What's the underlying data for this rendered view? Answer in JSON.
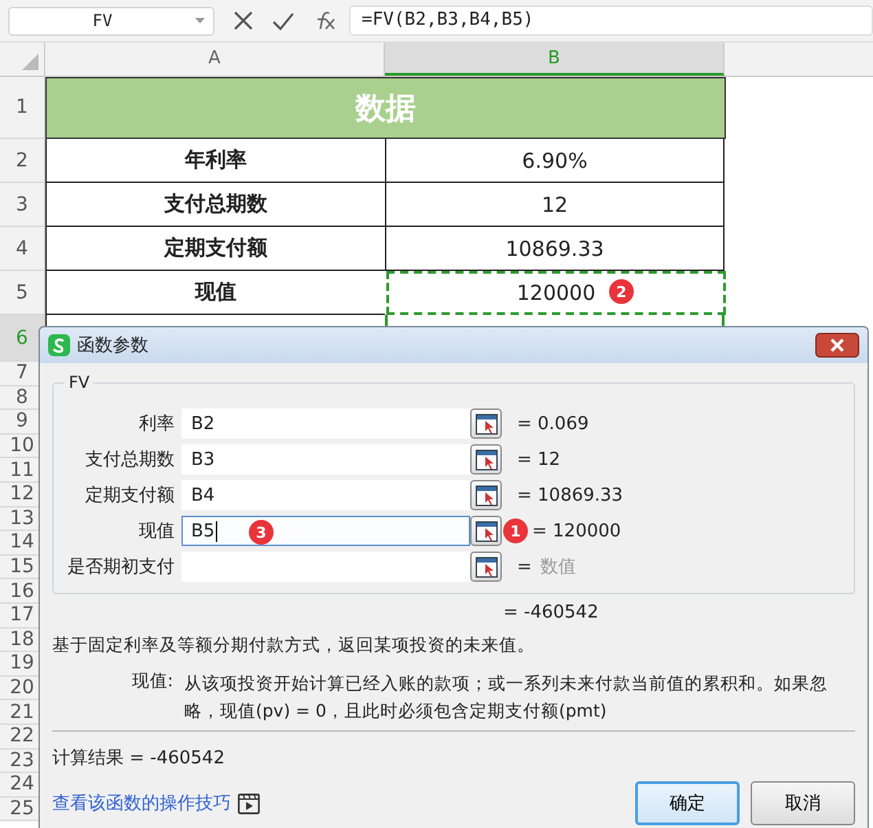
{
  "formula_bar": {
    "name_box": "FV",
    "formula": "=FV(B2,B3,B4,B5)"
  },
  "columns": [
    {
      "label": "A",
      "selected": false
    },
    {
      "label": "B",
      "selected": true
    }
  ],
  "sheet": {
    "title": "数据",
    "rows": [
      {
        "label": "年利率",
        "value": "6.90%",
        "marquee": false
      },
      {
        "label": "支付总期数",
        "value": "12",
        "marquee": false
      },
      {
        "label": "定期支付额",
        "value": "10869.33",
        "marquee": false
      },
      {
        "label": "现值",
        "value": "120000",
        "marquee": true,
        "badge": "2"
      }
    ]
  },
  "row_headers": [
    {
      "label": "1",
      "selected": false
    },
    {
      "label": "2",
      "selected": false
    },
    {
      "label": "3",
      "selected": false
    },
    {
      "label": "4",
      "selected": false
    },
    {
      "label": "5",
      "selected": false
    },
    {
      "label": "6",
      "selected": true
    },
    {
      "label": "7",
      "selected": false
    },
    {
      "label": "8",
      "selected": false
    },
    {
      "label": "9",
      "selected": false
    },
    {
      "label": "10",
      "selected": false
    },
    {
      "label": "11",
      "selected": false
    },
    {
      "label": "12",
      "selected": false
    },
    {
      "label": "13",
      "selected": false
    },
    {
      "label": "14",
      "selected": false
    },
    {
      "label": "15",
      "selected": false
    },
    {
      "label": "16",
      "selected": false
    },
    {
      "label": "17",
      "selected": false
    },
    {
      "label": "18",
      "selected": false
    },
    {
      "label": "19",
      "selected": false
    },
    {
      "label": "20",
      "selected": false
    },
    {
      "label": "21",
      "selected": false
    },
    {
      "label": "22",
      "selected": false
    },
    {
      "label": "23",
      "selected": false
    },
    {
      "label": "24",
      "selected": false
    },
    {
      "label": "25",
      "selected": false
    }
  ],
  "dialog": {
    "title": "函数参数",
    "group": "FV",
    "args": [
      {
        "kind": "value",
        "label": "利率",
        "value": "B2",
        "focused": false,
        "result": "= 0.069"
      },
      {
        "kind": "value",
        "label": "支付总期数",
        "value": "B3",
        "focused": false,
        "result": "= 12"
      },
      {
        "kind": "value",
        "label": "定期支付额",
        "value": "B4",
        "focused": false,
        "result": "= 10869.33"
      },
      {
        "kind": "value",
        "label": "现值",
        "value": "B5",
        "focused": true,
        "field_badge": "3",
        "button_badge": "1",
        "result": "= 120000"
      },
      {
        "kind": "hint",
        "label": "是否期初支付",
        "focused": false,
        "result_prefix": "=",
        "result": "数值"
      }
    ],
    "formula_result": "= -460542",
    "description": "基于固定利率及等额分期付款方式，返回某项投资的未来值。",
    "param_label": "现值:",
    "param_text": "从该项投资开始计算已经入账的款项；或一系列未来付款当前值的累积和。如果忽略，现值(pv) = 0，且此时必须包含定期支付额(pmt)",
    "calc_result": "计算结果 = -460542",
    "help_link": "查看该函数的操作技巧",
    "buttons": [
      {
        "label": "确定",
        "default": true
      },
      {
        "label": "取消",
        "default": false
      }
    ]
  }
}
